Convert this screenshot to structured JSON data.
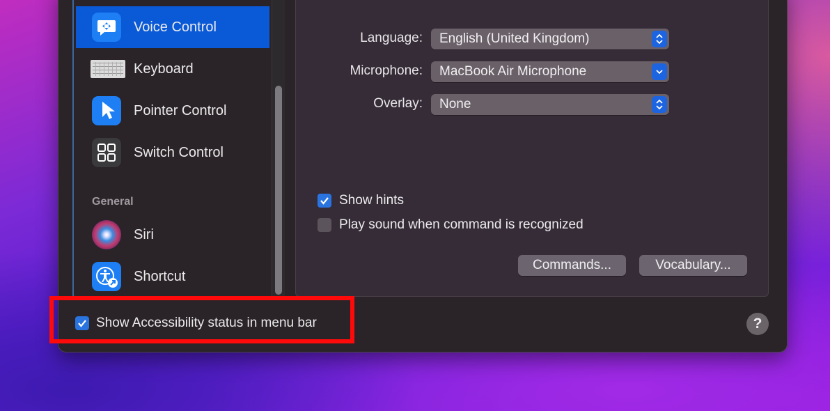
{
  "sidebar": {
    "items": [
      {
        "label": "Voice Control",
        "icon": "voice-control-icon",
        "selected": true
      },
      {
        "label": "Keyboard",
        "icon": "keyboard-icon",
        "selected": false
      },
      {
        "label": "Pointer Control",
        "icon": "pointer-control-icon",
        "selected": false
      },
      {
        "label": "Switch Control",
        "icon": "switch-control-icon",
        "selected": false
      }
    ],
    "section_general": "General",
    "general_items": [
      {
        "label": "Siri",
        "icon": "siri-icon"
      },
      {
        "label": "Shortcut",
        "icon": "accessibility-shortcut-icon"
      }
    ]
  },
  "main": {
    "language": {
      "label": "Language:",
      "value": "English (United Kingdom)"
    },
    "microphone": {
      "label": "Microphone:",
      "value": "MacBook Air Microphone"
    },
    "overlay": {
      "label": "Overlay:",
      "value": "None"
    },
    "show_hints": {
      "label": "Show hints",
      "checked": true
    },
    "play_sound": {
      "label": "Play sound when command is recognized",
      "checked": false
    },
    "commands_button": "Commands...",
    "vocabulary_button": "Vocabulary..."
  },
  "footer": {
    "show_status": {
      "label": "Show Accessibility status in menu bar",
      "checked": true
    },
    "help": "?"
  },
  "colors": {
    "accent": "#0a5ad8",
    "highlight": "#ff0a0a"
  }
}
